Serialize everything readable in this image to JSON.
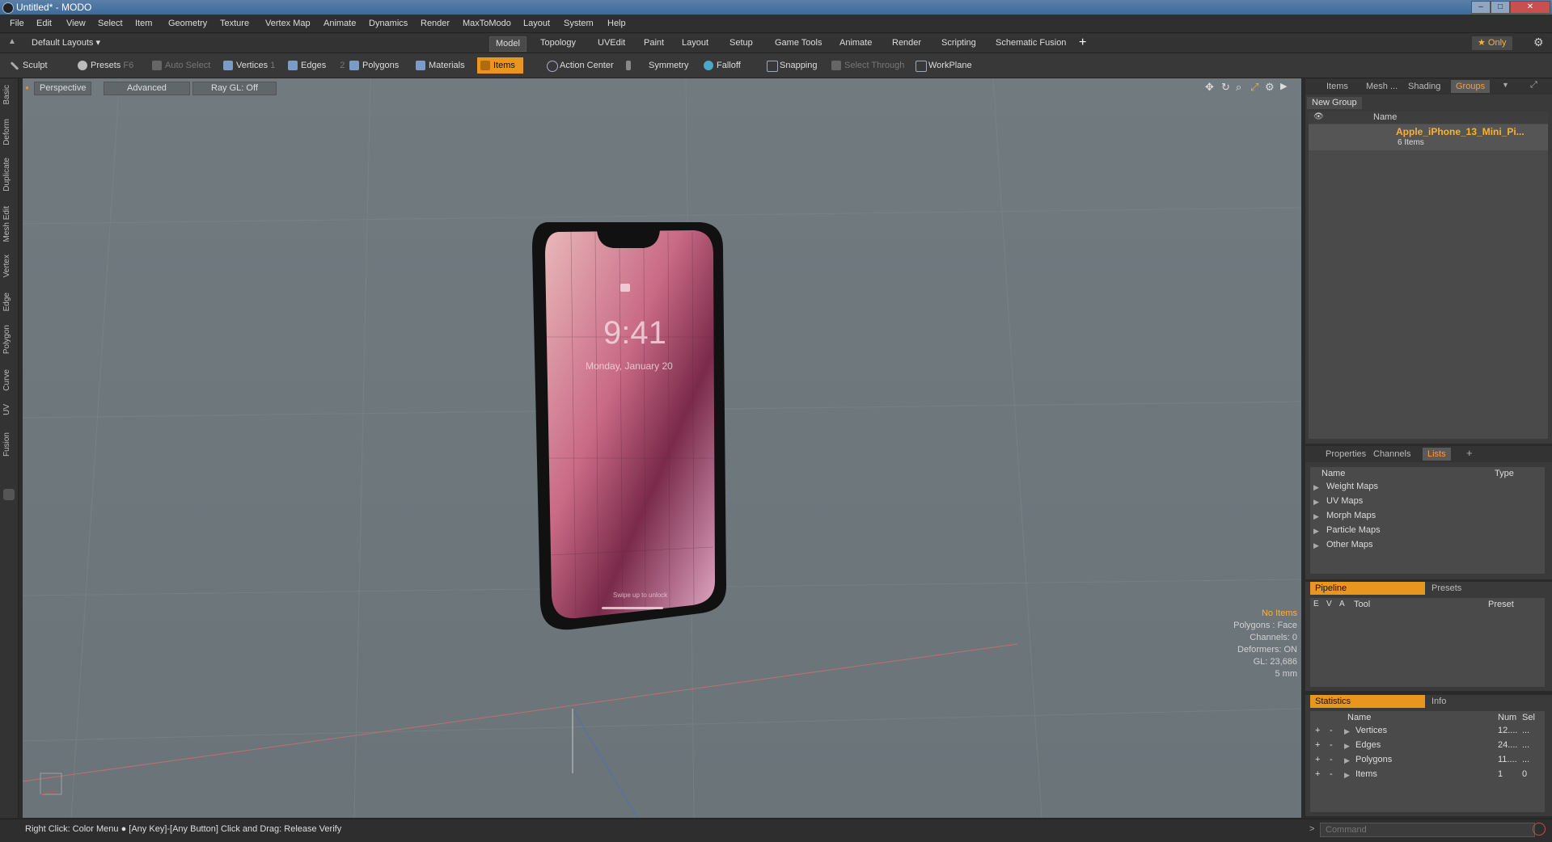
{
  "window": {
    "title": "Untitled* - MODO"
  },
  "menu": [
    "File",
    "Edit",
    "View",
    "Select",
    "Item",
    "Geometry",
    "Texture",
    "Vertex Map",
    "Animate",
    "Dynamics",
    "Render",
    "MaxToModo",
    "Layout",
    "System",
    "Help"
  ],
  "layout": {
    "selector": "Default Layouts",
    "tabs": [
      "Model",
      "Topology",
      "UVEdit",
      "Paint",
      "Layout",
      "Setup",
      "Game Tools",
      "Animate",
      "Render",
      "Scripting",
      "Schematic Fusion"
    ],
    "active_tab": "Model",
    "only_label": "Only"
  },
  "toolbar": {
    "sculpt": "Sculpt",
    "presets": "Presets",
    "presets_key": "F6",
    "auto_select": "Auto Select",
    "vertices": "Vertices",
    "vertices_key": "1",
    "edges": "Edges",
    "edges_key": "2",
    "polygons": "Polygons",
    "materials": "Materials",
    "items": "Items",
    "action_center": "Action Center",
    "symmetry": "Symmetry",
    "falloff": "Falloff",
    "snapping": "Snapping",
    "select_through": "Select Through",
    "workplane": "WorkPlane"
  },
  "left_tabs": [
    "Basic",
    "Deform",
    "Duplicate",
    "Mesh Edit",
    "Vertex",
    "Edge",
    "Polygon",
    "Curve",
    "UV",
    "Fusion"
  ],
  "viewport": {
    "view": "Perspective",
    "mode": "Advanced",
    "raygl": "Ray GL: Off",
    "phone_time": "9:41",
    "phone_date": "Monday, January 20",
    "phone_swipe": "Swipe up to unlock",
    "info": {
      "no_items": "No Items",
      "polygons": "Polygons : Face",
      "channels": "Channels: 0",
      "deformers": "Deformers: ON",
      "gl": "GL: 23,686",
      "scale": "5 mm"
    }
  },
  "groups_panel": {
    "tabs": [
      "Items",
      "Mesh ...",
      "Shading",
      "Groups"
    ],
    "active": "Groups",
    "new_group": "New Group",
    "name_header": "Name",
    "group_name": "Apple_iPhone_13_Mini_Pi...",
    "group_count": "6 Items"
  },
  "lists_panel": {
    "tabs": [
      "Properties",
      "Channels",
      "Lists"
    ],
    "active": "Lists",
    "headers": [
      "Name",
      "Type"
    ],
    "items": [
      "Weight Maps",
      "UV Maps",
      "Morph Maps",
      "Particle Maps",
      "Other Maps"
    ]
  },
  "pipeline_panel": {
    "tabs": [
      "Pipeline",
      "Presets"
    ],
    "headers": [
      "E",
      "V",
      "A",
      "Tool",
      "Preset"
    ]
  },
  "stats_panel": {
    "tabs": [
      "Statistics",
      "Info"
    ],
    "headers": [
      "Name",
      "Num",
      "Sel"
    ],
    "rows": [
      {
        "name": "Vertices",
        "num": "12....",
        "sel": "..."
      },
      {
        "name": "Edges",
        "num": "24....",
        "sel": "..."
      },
      {
        "name": "Polygons",
        "num": "11....",
        "sel": "..."
      },
      {
        "name": "Items",
        "num": "1",
        "sel": "0"
      }
    ]
  },
  "status": {
    "hint": "Right Click: Color Menu ● [Any Key]-[Any Button] Click and Drag: Release Verify",
    "command_placeholder": "Command"
  }
}
